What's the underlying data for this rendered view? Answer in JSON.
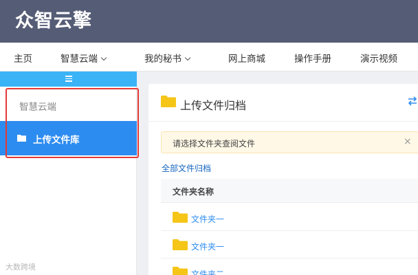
{
  "header": {
    "logo": "众智云擎"
  },
  "nav": {
    "items": [
      {
        "label": "主页"
      },
      {
        "label": "智慧云端"
      },
      {
        "label": "我的秘书"
      },
      {
        "label": "网上商城"
      },
      {
        "label": "操作手册"
      },
      {
        "label": "演示视频"
      }
    ]
  },
  "sidebar": {
    "group_label": "智慧云端",
    "active_item": {
      "label": "上传文件库",
      "icon": "folder-icon"
    }
  },
  "main": {
    "title": "上传文件归档",
    "alert": {
      "text": "请选择文件夹查阅文件",
      "close": "×"
    },
    "breadcrumb": "全部文件归档",
    "table": {
      "header": "文件夹名称",
      "rows": [
        {
          "name": "文件夹一"
        },
        {
          "name": "文件夹一"
        },
        {
          "name": "文件夹二"
        }
      ]
    }
  },
  "watermark": "大数跨境",
  "colors": {
    "header_bg": "#555c75",
    "sidebar_toggle": "#3bb3f7",
    "active_item": "#2d8cf0",
    "folder": "#f5c518",
    "highlight": "#e53935"
  }
}
